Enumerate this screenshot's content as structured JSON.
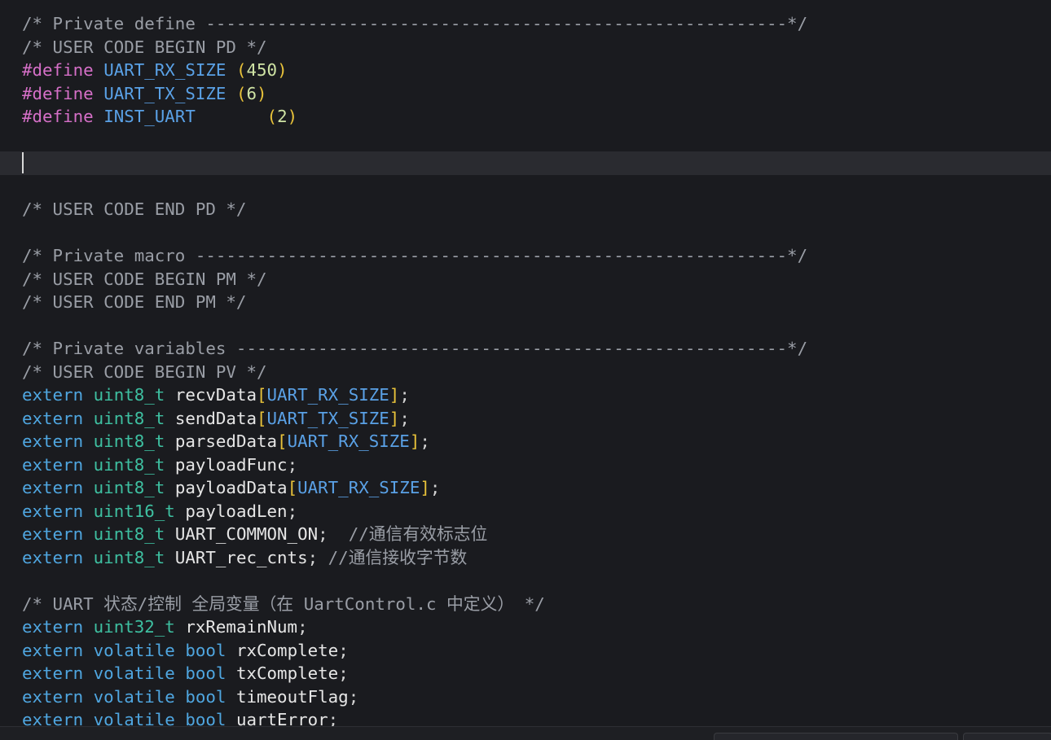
{
  "editor": {
    "lines": [
      [
        {
          "t": "/* Private define ---------------------------------------------------------*/",
          "c": "comment"
        }
      ],
      [
        {
          "t": "/* USER CODE BEGIN PD */",
          "c": "comment"
        }
      ],
      [
        {
          "t": "#define",
          "c": "directive"
        },
        {
          "t": " ",
          "c": "punct"
        },
        {
          "t": "UART_RX_SIZE",
          "c": "macro"
        },
        {
          "t": " ",
          "c": "punct"
        },
        {
          "t": "(",
          "c": "paren"
        },
        {
          "t": "450",
          "c": "number"
        },
        {
          "t": ")",
          "c": "paren"
        }
      ],
      [
        {
          "t": "#define",
          "c": "directive"
        },
        {
          "t": " ",
          "c": "punct"
        },
        {
          "t": "UART_TX_SIZE",
          "c": "macro"
        },
        {
          "t": " ",
          "c": "punct"
        },
        {
          "t": "(",
          "c": "paren"
        },
        {
          "t": "6",
          "c": "number"
        },
        {
          "t": ")",
          "c": "paren"
        }
      ],
      [
        {
          "t": "#define",
          "c": "directive"
        },
        {
          "t": " ",
          "c": "punct"
        },
        {
          "t": "INST_UART",
          "c": "macro"
        },
        {
          "t": "       ",
          "c": "punct"
        },
        {
          "t": "(",
          "c": "paren"
        },
        {
          "t": "2",
          "c": "number"
        },
        {
          "t": ")",
          "c": "paren"
        }
      ],
      [],
      [],
      [],
      [
        {
          "t": "/* USER CODE END PD */",
          "c": "comment"
        }
      ],
      [],
      [
        {
          "t": "/* Private macro ----------------------------------------------------------*/",
          "c": "comment"
        }
      ],
      [
        {
          "t": "/* USER CODE BEGIN PM */",
          "c": "comment"
        }
      ],
      [
        {
          "t": "/* USER CODE END PM */",
          "c": "comment"
        }
      ],
      [],
      [
        {
          "t": "/* Private variables ------------------------------------------------------*/",
          "c": "comment"
        }
      ],
      [
        {
          "t": "/* USER CODE BEGIN PV */",
          "c": "comment"
        }
      ],
      [
        {
          "t": "extern",
          "c": "storage"
        },
        {
          "t": " ",
          "c": "punct"
        },
        {
          "t": "uint8_t",
          "c": "type"
        },
        {
          "t": " recvData",
          "c": "ident"
        },
        {
          "t": "[",
          "c": "paren"
        },
        {
          "t": "UART_RX_SIZE",
          "c": "macro"
        },
        {
          "t": "]",
          "c": "paren"
        },
        {
          "t": ";",
          "c": "punct"
        }
      ],
      [
        {
          "t": "extern",
          "c": "storage"
        },
        {
          "t": " ",
          "c": "punct"
        },
        {
          "t": "uint8_t",
          "c": "type"
        },
        {
          "t": " sendData",
          "c": "ident"
        },
        {
          "t": "[",
          "c": "paren"
        },
        {
          "t": "UART_TX_SIZE",
          "c": "macro"
        },
        {
          "t": "]",
          "c": "paren"
        },
        {
          "t": ";",
          "c": "punct"
        }
      ],
      [
        {
          "t": "extern",
          "c": "storage"
        },
        {
          "t": " ",
          "c": "punct"
        },
        {
          "t": "uint8_t",
          "c": "type"
        },
        {
          "t": " parsedData",
          "c": "ident"
        },
        {
          "t": "[",
          "c": "paren"
        },
        {
          "t": "UART_RX_SIZE",
          "c": "macro"
        },
        {
          "t": "]",
          "c": "paren"
        },
        {
          "t": ";",
          "c": "punct"
        }
      ],
      [
        {
          "t": "extern",
          "c": "storage"
        },
        {
          "t": " ",
          "c": "punct"
        },
        {
          "t": "uint8_t",
          "c": "type"
        },
        {
          "t": " payloadFunc",
          "c": "ident"
        },
        {
          "t": ";",
          "c": "punct"
        }
      ],
      [
        {
          "t": "extern",
          "c": "storage"
        },
        {
          "t": " ",
          "c": "punct"
        },
        {
          "t": "uint8_t",
          "c": "type"
        },
        {
          "t": " payloadData",
          "c": "ident"
        },
        {
          "t": "[",
          "c": "paren"
        },
        {
          "t": "UART_RX_SIZE",
          "c": "macro"
        },
        {
          "t": "]",
          "c": "paren"
        },
        {
          "t": ";",
          "c": "punct"
        }
      ],
      [
        {
          "t": "extern",
          "c": "storage"
        },
        {
          "t": " ",
          "c": "punct"
        },
        {
          "t": "uint16_t",
          "c": "type"
        },
        {
          "t": " payloadLen",
          "c": "ident"
        },
        {
          "t": ";",
          "c": "punct"
        }
      ],
      [
        {
          "t": "extern",
          "c": "storage"
        },
        {
          "t": " ",
          "c": "punct"
        },
        {
          "t": "uint8_t",
          "c": "type"
        },
        {
          "t": " UART_COMMON_ON",
          "c": "ident"
        },
        {
          "t": ";  ",
          "c": "punct"
        },
        {
          "t": "//通信有效标志位",
          "c": "comment"
        }
      ],
      [
        {
          "t": "extern",
          "c": "storage"
        },
        {
          "t": " ",
          "c": "punct"
        },
        {
          "t": "uint8_t",
          "c": "type"
        },
        {
          "t": " UART_rec_cnts",
          "c": "ident"
        },
        {
          "t": "; ",
          "c": "punct"
        },
        {
          "t": "//通信接收字节数",
          "c": "comment"
        }
      ],
      [],
      [
        {
          "t": "/* UART 状态/控制 全局变量（在 UartControl.c 中定义） */",
          "c": "comment"
        }
      ],
      [
        {
          "t": "extern",
          "c": "storage"
        },
        {
          "t": " ",
          "c": "punct"
        },
        {
          "t": "uint32_t",
          "c": "type"
        },
        {
          "t": " rxRemainNum",
          "c": "ident"
        },
        {
          "t": ";",
          "c": "punct"
        }
      ],
      [
        {
          "t": "extern",
          "c": "storage"
        },
        {
          "t": " ",
          "c": "punct"
        },
        {
          "t": "volatile",
          "c": "storage"
        },
        {
          "t": " ",
          "c": "punct"
        },
        {
          "t": "bool",
          "c": "storage"
        },
        {
          "t": " rxComplete",
          "c": "ident"
        },
        {
          "t": ";",
          "c": "punct"
        }
      ],
      [
        {
          "t": "extern",
          "c": "storage"
        },
        {
          "t": " ",
          "c": "punct"
        },
        {
          "t": "volatile",
          "c": "storage"
        },
        {
          "t": " ",
          "c": "punct"
        },
        {
          "t": "bool",
          "c": "storage"
        },
        {
          "t": " txComplete",
          "c": "ident"
        },
        {
          "t": ";",
          "c": "punct"
        }
      ],
      [
        {
          "t": "extern",
          "c": "storage"
        },
        {
          "t": " ",
          "c": "punct"
        },
        {
          "t": "volatile",
          "c": "storage"
        },
        {
          "t": " ",
          "c": "punct"
        },
        {
          "t": "bool",
          "c": "storage"
        },
        {
          "t": " timeoutFlag",
          "c": "ident"
        },
        {
          "t": ";",
          "c": "punct"
        }
      ],
      [
        {
          "t": "extern",
          "c": "storage"
        },
        {
          "t": " ",
          "c": "punct"
        },
        {
          "t": "volatile",
          "c": "storage"
        },
        {
          "t": " ",
          "c": "punct"
        },
        {
          "t": "bool",
          "c": "storage"
        },
        {
          "t": " uartError",
          "c": "ident"
        },
        {
          "t": ";",
          "c": "punct"
        }
      ]
    ],
    "cursor_line": 6
  }
}
